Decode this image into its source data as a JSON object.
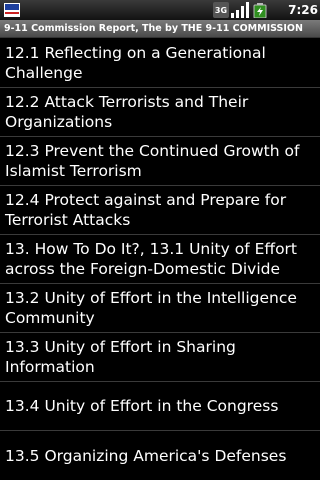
{
  "statusbar": {
    "time": "7:26",
    "network_type": "3G",
    "notification_icon": "flag-icon",
    "signal_icon": "signal-icon",
    "battery_icon": "battery-charging-icon"
  },
  "app": {
    "title": "9-11 Commission Report, The by THE 9-11 COMMISSION"
  },
  "toc": {
    "items": [
      {
        "label": "12.1 Reflecting on a Generational Challenge"
      },
      {
        "label": "12.2 Attack Terrorists and Their Organizations"
      },
      {
        "label": "12.3 Prevent the Continued Growth of Islamist Terrorism"
      },
      {
        "label": "12.4 Protect against and Prepare for Terrorist Attacks"
      },
      {
        "label": "13. How To Do It?, 13.1 Unity of Effort across the Foreign-Domestic Divide"
      },
      {
        "label": "13.2 Unity of Effort in the Intelligence Community"
      },
      {
        "label": "13.3 Unity of Effort in Sharing Information"
      },
      {
        "label": "13.4 Unity of Effort in the Congress"
      },
      {
        "label": "13.5 Organizing America's Defenses"
      }
    ]
  }
}
